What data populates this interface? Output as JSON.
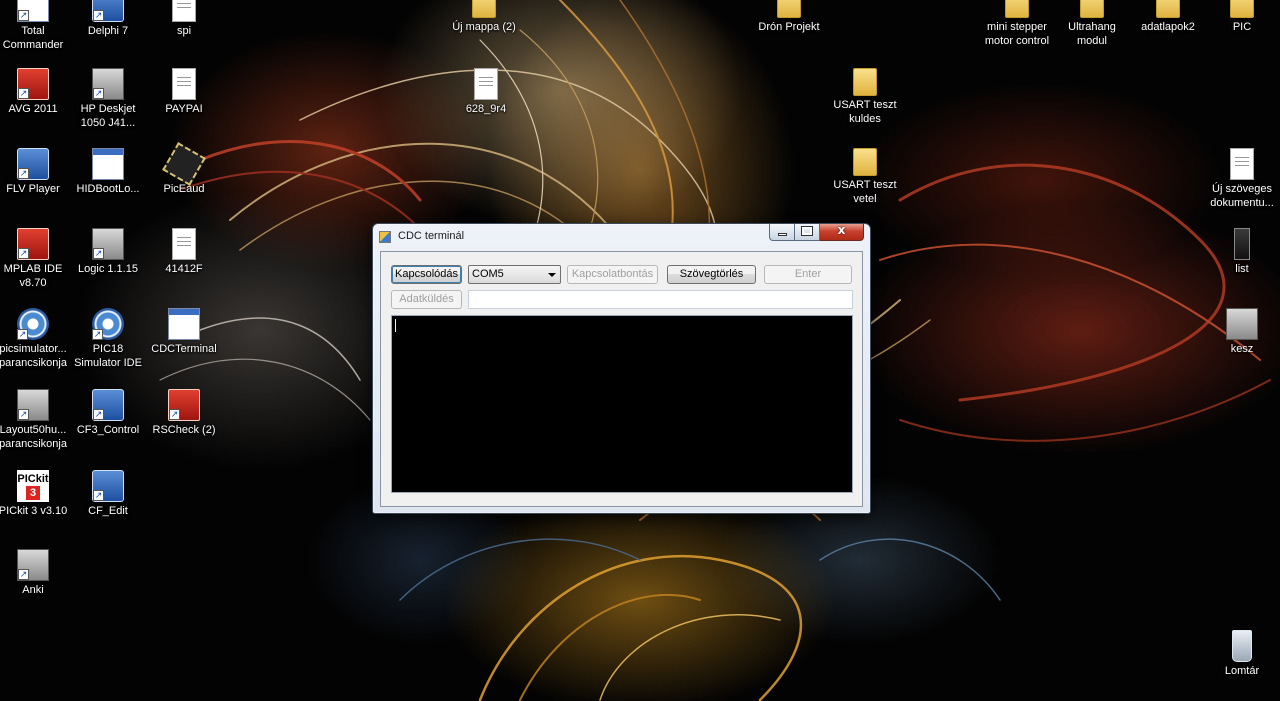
{
  "desktop": {
    "left_icons": [
      {
        "label": "Total Commander",
        "icon": "total-commander-icon"
      },
      {
        "label": "Delphi 7",
        "icon": "delphi-icon"
      },
      {
        "label": "spi",
        "icon": "text-document-icon"
      },
      {
        "label": "AVG 2011",
        "icon": "avg-antivirus-icon"
      },
      {
        "label": "HP Deskjet 1050 J41...",
        "icon": "printer-icon"
      },
      {
        "label": "PAYPAI",
        "icon": "text-document-icon"
      },
      {
        "label": "FLV Player",
        "icon": "flv-player-icon"
      },
      {
        "label": "HIDBootLo...",
        "icon": "application-window-icon"
      },
      {
        "label": "PicEaud",
        "icon": "microchip-icon"
      },
      {
        "label": "MPLAB IDE v8.70",
        "icon": "mplab-icon"
      },
      {
        "label": "Logic 1.1.15",
        "icon": "logic-analyzer-icon"
      },
      {
        "label": "41412F",
        "icon": "pdf-document-icon"
      },
      {
        "label": "picsimulator... parancsikonja",
        "icon": "picsimulator-icon"
      },
      {
        "label": "PIC18 Simulator IDE",
        "icon": "picsimulator-icon"
      },
      {
        "label": "CDCTerminal",
        "icon": "application-window-icon"
      },
      {
        "label": "Layout50hu... parancsikonja",
        "icon": "layout-tool-icon"
      },
      {
        "label": "CF3_Control",
        "icon": "cf3-control-icon"
      },
      {
        "label": "RSCheck (2)",
        "icon": "rscheck-icon"
      },
      {
        "label": "PICkit 3 v3.10",
        "icon": "pickit-icon"
      },
      {
        "label": "CF_Edit",
        "icon": "cf-edit-icon"
      },
      {
        "label": "Anki",
        "icon": "anki-icon"
      }
    ],
    "center_icons": [
      {
        "label": "Új mappa (2)",
        "icon": "folder-icon"
      },
      {
        "label": "628_9r4",
        "icon": "text-document-icon"
      },
      {
        "label": "Drón Projekt",
        "icon": "folder-icon"
      },
      {
        "label": "USART teszt kuldes",
        "icon": "folder-icon"
      },
      {
        "label": "USART teszt vetel",
        "icon": "folder-icon"
      }
    ],
    "right_icons": [
      {
        "label": "mini stepper motor control",
        "icon": "folder-icon"
      },
      {
        "label": "Ultrahang modul",
        "icon": "folder-icon"
      },
      {
        "label": "adatlapok2",
        "icon": "folder-icon"
      },
      {
        "label": "PIC",
        "icon": "folder-icon"
      },
      {
        "label": "Új szöveges dokumentu...",
        "icon": "text-document-icon"
      },
      {
        "label": "list",
        "icon": "archive-icon"
      },
      {
        "label": "kesz",
        "icon": "image-file-icon"
      },
      {
        "label": "Lomtár",
        "icon": "recycle-bin-icon"
      }
    ]
  },
  "window": {
    "title": "CDC terminál",
    "close_glyph": "x",
    "connect_label": "Kapcsolódás",
    "port_value": "COM5",
    "disconnect_label": "Kapcsolatbontás",
    "clear_label": "Szövegtörlés",
    "enter_label": "Enter",
    "send_label": "Adatküldés",
    "send_text": "",
    "terminal_text": ""
  },
  "colors": {
    "terminal_bg": "#000000",
    "close_button": "#c8412e",
    "window_frame": "#dfe6ef"
  }
}
